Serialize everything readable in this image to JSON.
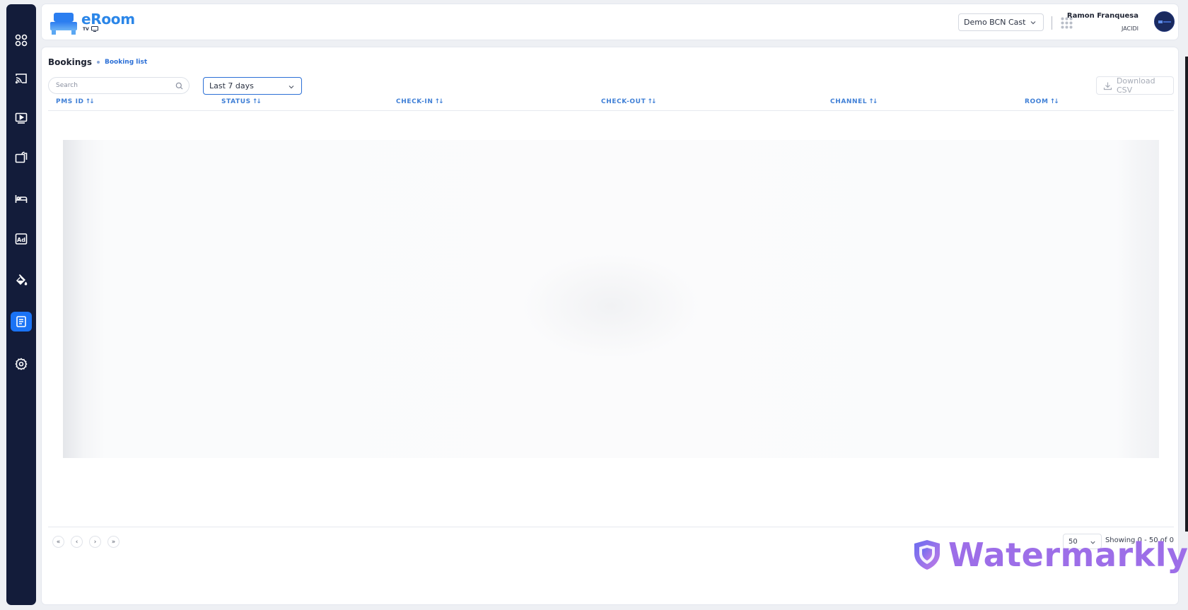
{
  "app": {
    "logo_text": "eRoom",
    "logo_sub": "TV"
  },
  "header": {
    "property_selected": "Demo BCN Cast",
    "user_name": "Ramon Franquesa",
    "user_org": "JACIDI"
  },
  "sidebar": {
    "items": [
      {
        "name": "dashboard",
        "icon": "grid-icon"
      },
      {
        "name": "cast",
        "icon": "cast-icon"
      },
      {
        "name": "media",
        "icon": "play-icon"
      },
      {
        "name": "devices",
        "icon": "devices-icon"
      },
      {
        "name": "rooms",
        "icon": "bed-icon"
      },
      {
        "name": "ads",
        "icon": "ad-icon"
      },
      {
        "name": "branding",
        "icon": "paint-bucket-icon"
      },
      {
        "name": "bookings",
        "icon": "bookings-icon",
        "active": true
      },
      {
        "name": "settings",
        "icon": "gear-icon"
      }
    ]
  },
  "page": {
    "title": "Bookings",
    "breadcrumb_current": "Booking list",
    "search_placeholder": "Search",
    "range_selected": "Last 7 days",
    "csv_label": "Download CSV"
  },
  "table": {
    "columns": [
      {
        "label": "PMS ID",
        "sort": "↑↓"
      },
      {
        "label": "STATUS",
        "sort": "↑↓"
      },
      {
        "label": "CHECK-IN",
        "sort": "↑↓"
      },
      {
        "label": "CHECK-OUT",
        "sort": "↑↓"
      },
      {
        "label": "CHANNEL",
        "sort": "↑↓"
      },
      {
        "label": "ROOM",
        "sort": "↑↓"
      }
    ],
    "rows": []
  },
  "pagination": {
    "first": "«",
    "prev": "‹",
    "next": "›",
    "last": "»",
    "page_size": "50",
    "showing": "Showing 0 - 50 of 0"
  },
  "watermark": {
    "text": "Watermarkly"
  },
  "colors": {
    "sidebar_bg": "#131c3a",
    "accent": "#1a73f5",
    "link": "#2b6fd6",
    "watermark": "#9d6ee8"
  }
}
